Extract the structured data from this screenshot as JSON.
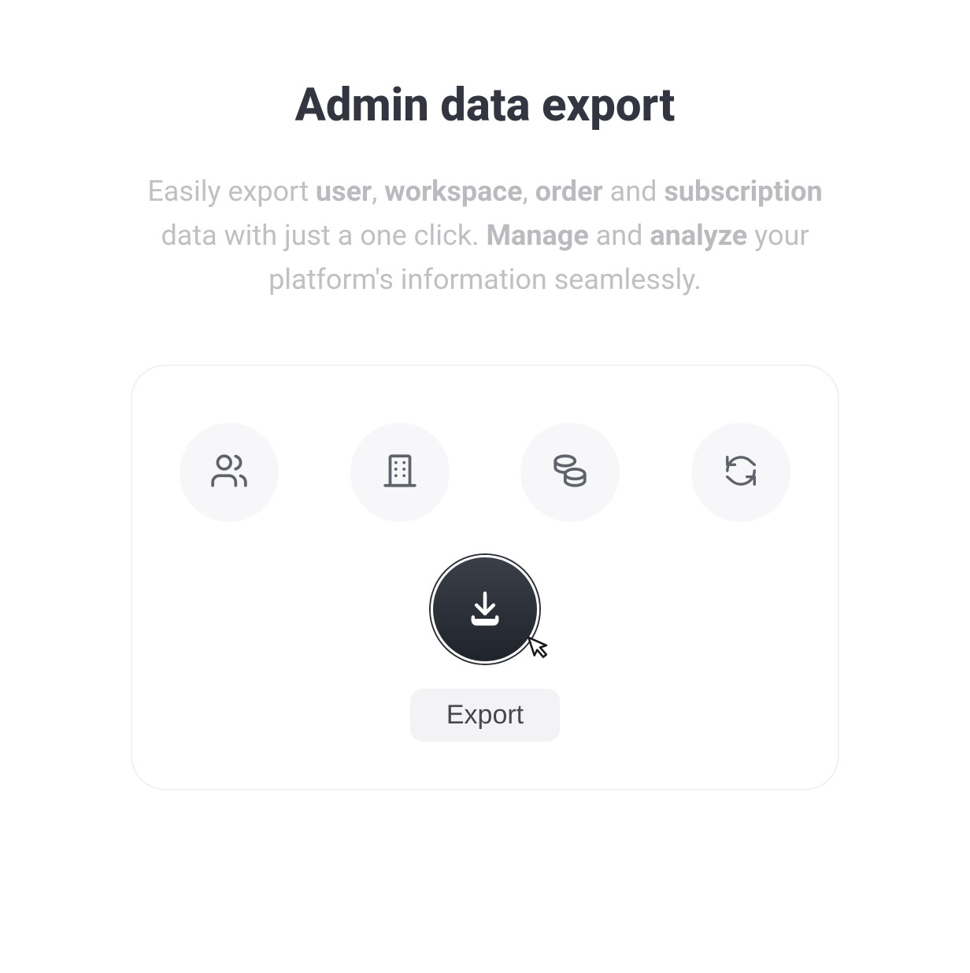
{
  "title": "Admin data export",
  "description": {
    "text1": "Easily export ",
    "b1": "user",
    "text2": ", ",
    "b2": "workspace",
    "text3": ", ",
    "b3": "order",
    "text4": " and ",
    "b4": "subscription",
    "text5": " data with just a one click. ",
    "b5": "Manage",
    "text6": " and ",
    "b6": "analyze",
    "text7": " your platform's information seamlessly."
  },
  "icons": {
    "users": "users-icon",
    "workspace": "building-icon",
    "orders": "coins-icon",
    "subscription": "refresh-icon"
  },
  "export": {
    "label": "Export"
  }
}
